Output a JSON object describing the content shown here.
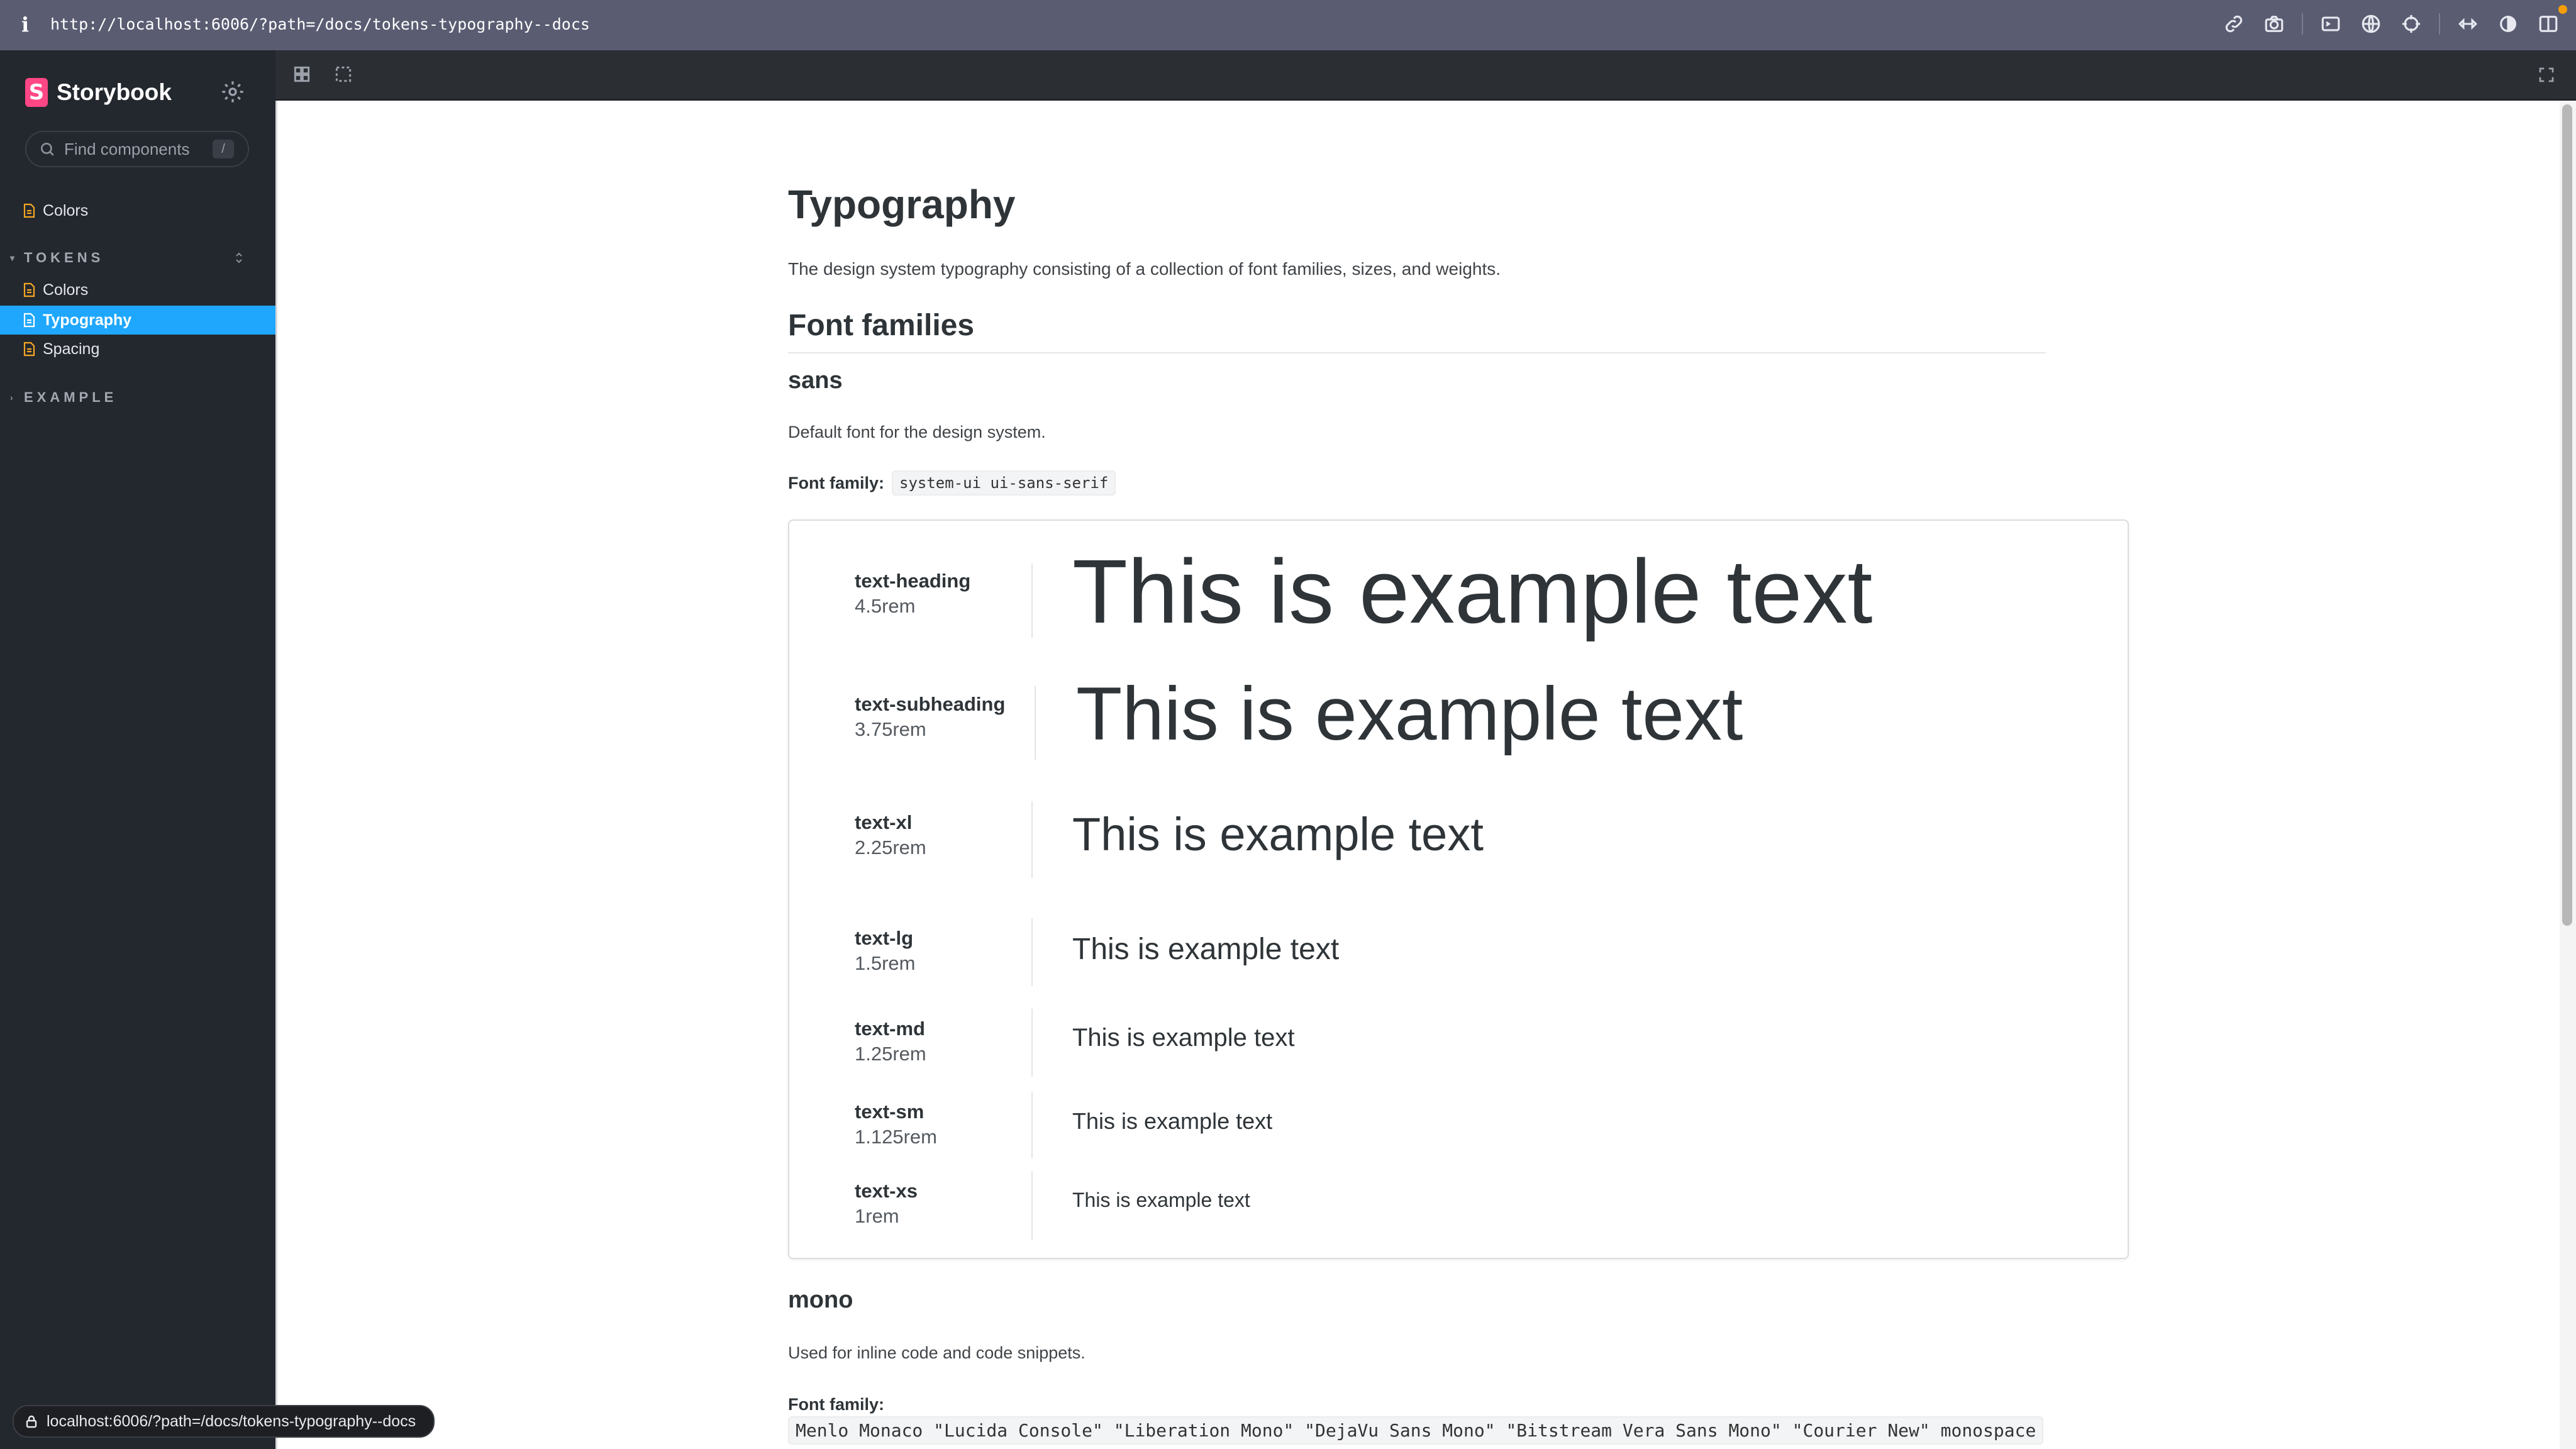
{
  "browser": {
    "url": "http://localhost:6006/?path=/docs/tokens-typography--docs",
    "info_glyph": "i",
    "icons": [
      "link-icon",
      "camera-icon",
      "terminal-icon",
      "globe-icon",
      "crosshair-icon",
      "expand-icon",
      "contrast-icon",
      "sidebar-icon"
    ]
  },
  "sidebar": {
    "brand": "Storybook",
    "brand_mark": "S",
    "search_placeholder": "Find components",
    "search_shortcut": "/",
    "top_items": [
      {
        "label": "Colors"
      }
    ],
    "groups": [
      {
        "label": "TOKENS",
        "items": [
          {
            "label": "Colors"
          },
          {
            "label": "Typography",
            "active": true
          },
          {
            "label": "Spacing"
          }
        ]
      },
      {
        "label": "EXAMPLE",
        "items": []
      }
    ]
  },
  "doc": {
    "title": "Typography",
    "intro": "The design system typography consisting of a collection of font families, sizes, and weights.",
    "section_heading": "Font families",
    "sans": {
      "heading": "sans",
      "description": "Default font for the design system.",
      "font_family_label": "Font family:",
      "font_family_value": "system-ui ui-sans-serif"
    },
    "sample_text": "This is example text",
    "type_scale": [
      {
        "name": "text-heading",
        "size": "4.5rem"
      },
      {
        "name": "text-subheading",
        "size": "3.75rem"
      },
      {
        "name": "text-xl",
        "size": "2.25rem"
      },
      {
        "name": "text-lg",
        "size": "1.5rem"
      },
      {
        "name": "text-md",
        "size": "1.25rem"
      },
      {
        "name": "text-sm",
        "size": "1.125rem"
      },
      {
        "name": "text-xs",
        "size": "1rem"
      }
    ],
    "mono": {
      "heading": "mono",
      "description": "Used for inline code and code snippets.",
      "font_family_label": "Font family:",
      "font_family_value": "Menlo Monaco \"Lucida Console\" \"Liberation Mono\" \"DejaVu Sans Mono\" \"Bitstream Vera Sans Mono\" \"Courier New\" monospace"
    }
  },
  "status_bar": {
    "link_preview": "localhost:6006/?path=/docs/tokens-typography--docs"
  },
  "colors": {
    "accent": "#1ea7fd",
    "brand": "#ff4785",
    "sidebar_bg": "#23272e",
    "doc_icon": "#f5a623"
  }
}
